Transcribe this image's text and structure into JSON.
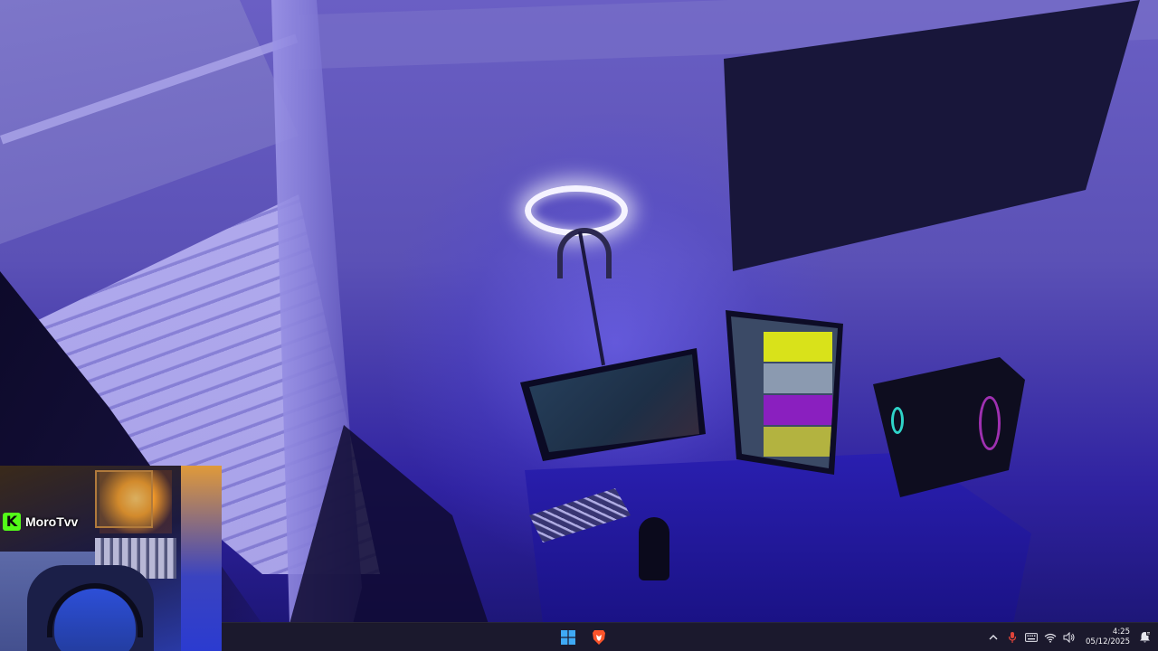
{
  "stream": {
    "platform_icon": "kick-logo-icon",
    "kick_letter": "K",
    "streamer_name": "MoroTvv",
    "brand_color": "#53fc18"
  },
  "taskbar": {
    "pinned": [
      {
        "name": "start-button",
        "icon": "windows-logo-icon"
      },
      {
        "name": "brave-browser",
        "icon": "brave-lion-icon"
      }
    ],
    "tray": {
      "overflow_icon": "chevron-up-icon",
      "mic_icon": "microphone-icon",
      "mic_color": "#e0443a",
      "keyboard_icon": "keyboard-icon",
      "wifi_icon": "wifi-icon",
      "volume_icon": "speaker-icon",
      "notification_icon": "notification-bell-icon"
    },
    "clock": {
      "time": "4:25",
      "date": "05/12/2025"
    },
    "accent": "#0a84ff"
  }
}
